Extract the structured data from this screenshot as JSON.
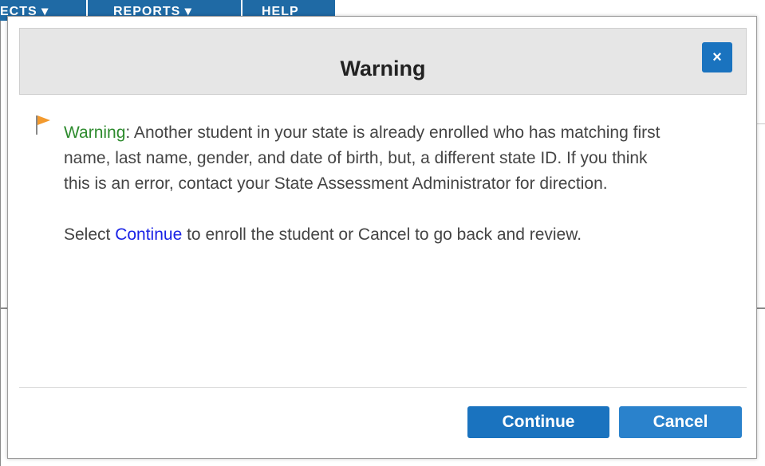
{
  "background_nav": {
    "items": [
      {
        "label": "ECTS ▾"
      },
      {
        "label": "REPORTS ▾"
      },
      {
        "label": "HELP"
      }
    ]
  },
  "dialog": {
    "title": "Warning",
    "close_label": "×",
    "warning_label": "Warning",
    "warning_text": ": Another student in your state is already enrolled who has matching first name, last name, gender, and date of birth, but, a different state ID. If you think this is an error, contact your State Assessment Administrator for direction.",
    "select_prefix": "Select ",
    "select_link": "Continue",
    "select_suffix": " to enroll the student or Cancel to go back and review.",
    "continue_label": "Continue",
    "cancel_label": "Cancel"
  },
  "colors": {
    "accent": "#1a73bf",
    "warning_green": "#2e8b2e",
    "flag_orange": "#f39a2e",
    "link_blue": "#1a23e6"
  },
  "icons": {
    "close": "close-icon",
    "flag": "flag-icon"
  }
}
